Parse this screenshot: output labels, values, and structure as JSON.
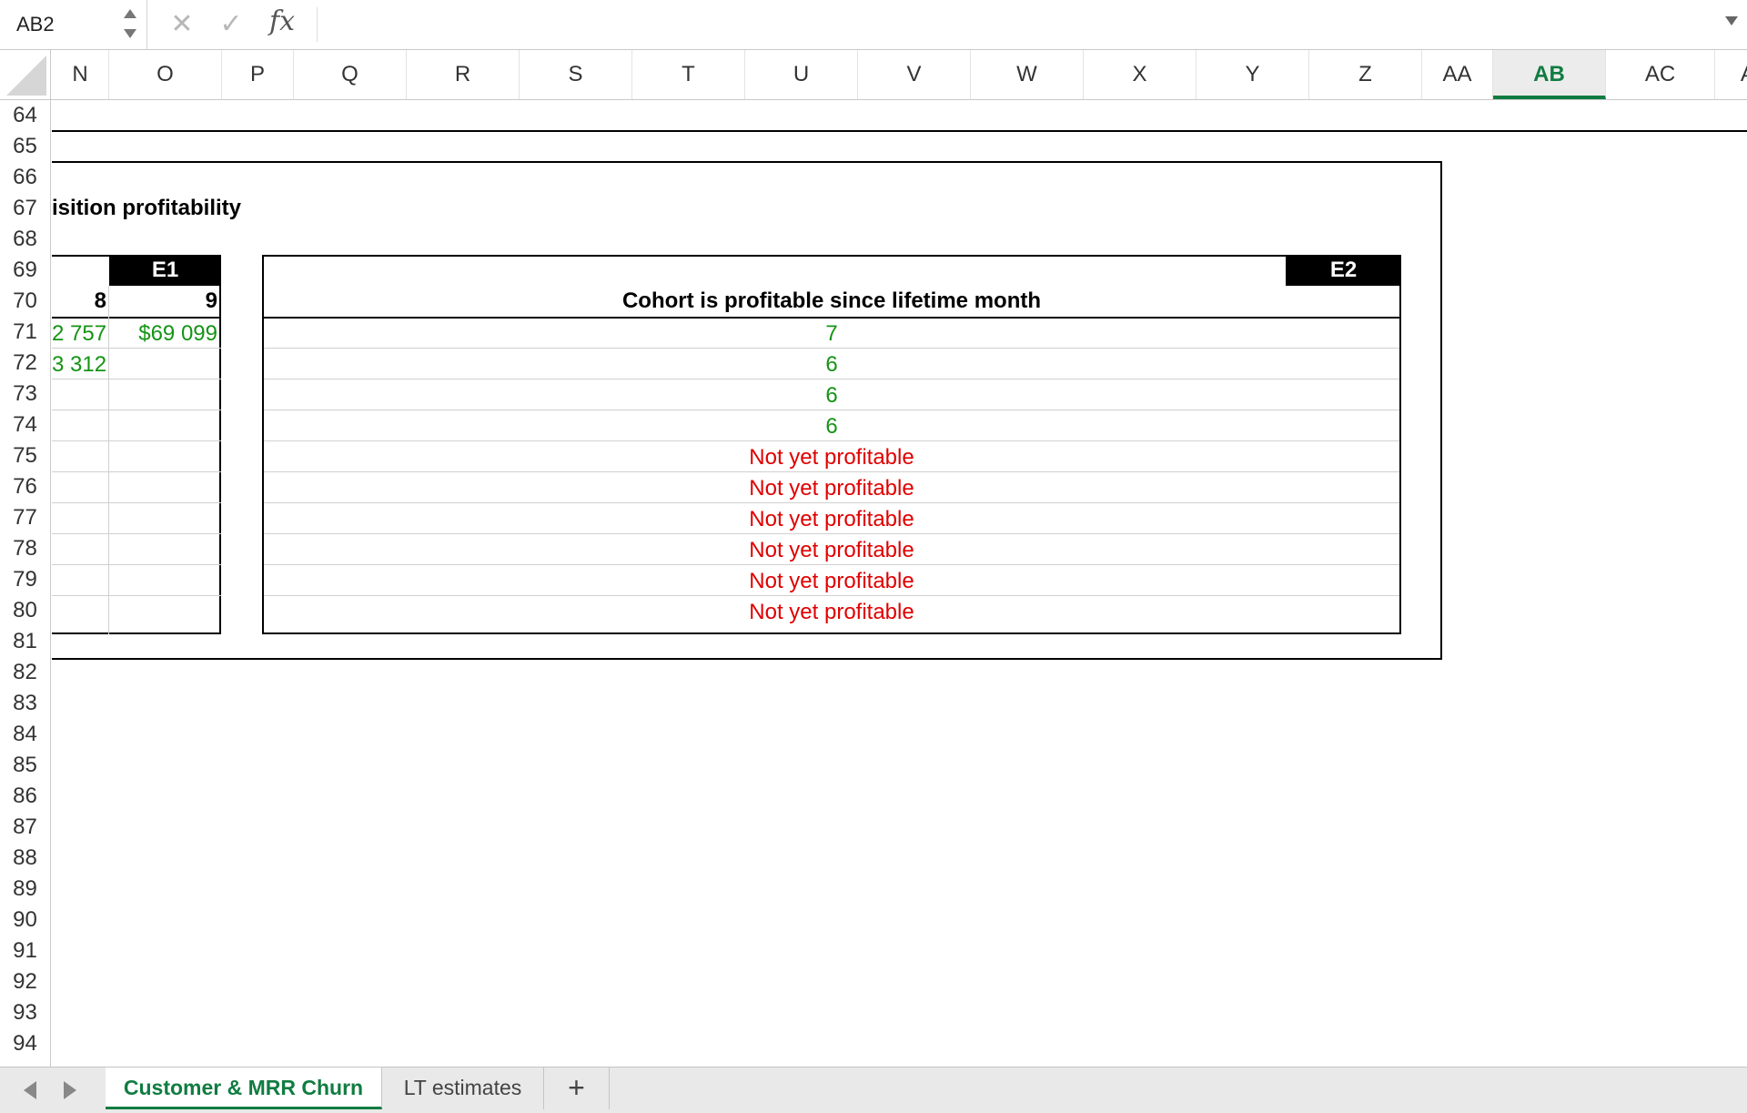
{
  "formula_bar": {
    "name_box": "AB2",
    "cancel_icon": "✕",
    "enter_icon": "✓",
    "fx_label": "fx",
    "formula": ""
  },
  "columns": [
    "N",
    "O",
    "P",
    "Q",
    "R",
    "S",
    "T",
    "U",
    "V",
    "W",
    "X",
    "Y",
    "Z",
    "AA",
    "AB",
    "AC",
    "AD"
  ],
  "selected_column": "AB",
  "rows": [
    "64",
    "65",
    "66",
    "67",
    "68",
    "69",
    "70",
    "71",
    "72",
    "73",
    "74",
    "75",
    "76",
    "77",
    "78",
    "79",
    "80",
    "81",
    "82",
    "83",
    "84",
    "85",
    "86",
    "87",
    "88",
    "89",
    "90",
    "91",
    "92",
    "93",
    "94"
  ],
  "section_title": "isition profitability",
  "table_e1": {
    "tag": "E1",
    "headers": [
      "8",
      "9"
    ],
    "rows": [
      [
        "2 757",
        "$69 099"
      ],
      [
        "3 312",
        ""
      ]
    ]
  },
  "table_e2": {
    "tag": "E2",
    "header": "Cohort is profitable since lifetime month",
    "values": [
      "7",
      "6",
      "6",
      "6",
      "Not yet profitable",
      "Not yet profitable",
      "Not yet profitable",
      "Not yet profitable",
      "Not yet profitable",
      "Not yet profitable"
    ]
  },
  "sheet_tabs": {
    "tabs": [
      {
        "label": "Customer & MRR Churn",
        "active": true
      },
      {
        "label": "LT estimates",
        "active": false
      }
    ],
    "add_label": "+"
  },
  "colors": {
    "accent": "#107c41",
    "positive": "#149414",
    "negative": "#e00000"
  }
}
